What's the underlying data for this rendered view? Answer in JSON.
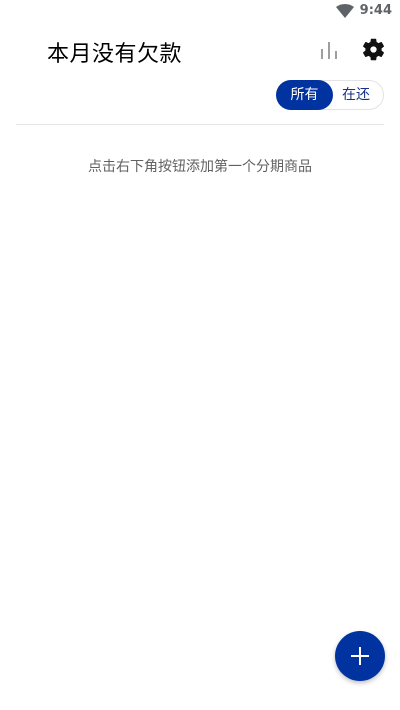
{
  "status_bar": {
    "time": "9:44",
    "icons": [
      "wifi-icon"
    ]
  },
  "header": {
    "title": "本月没有欠款",
    "actions": [
      "bar-chart-icon",
      "gear-icon"
    ]
  },
  "filter": {
    "options": [
      "所有",
      "在还"
    ],
    "selected": "所有"
  },
  "empty_state": {
    "message": "点击右下角按钮添加第一个分期商品"
  },
  "fab": {
    "icon": "plus-icon"
  },
  "colors": {
    "primary": "#0033a0",
    "title_text": "#000000",
    "muted_text": "#616161",
    "divider": "#e6e6e6"
  }
}
